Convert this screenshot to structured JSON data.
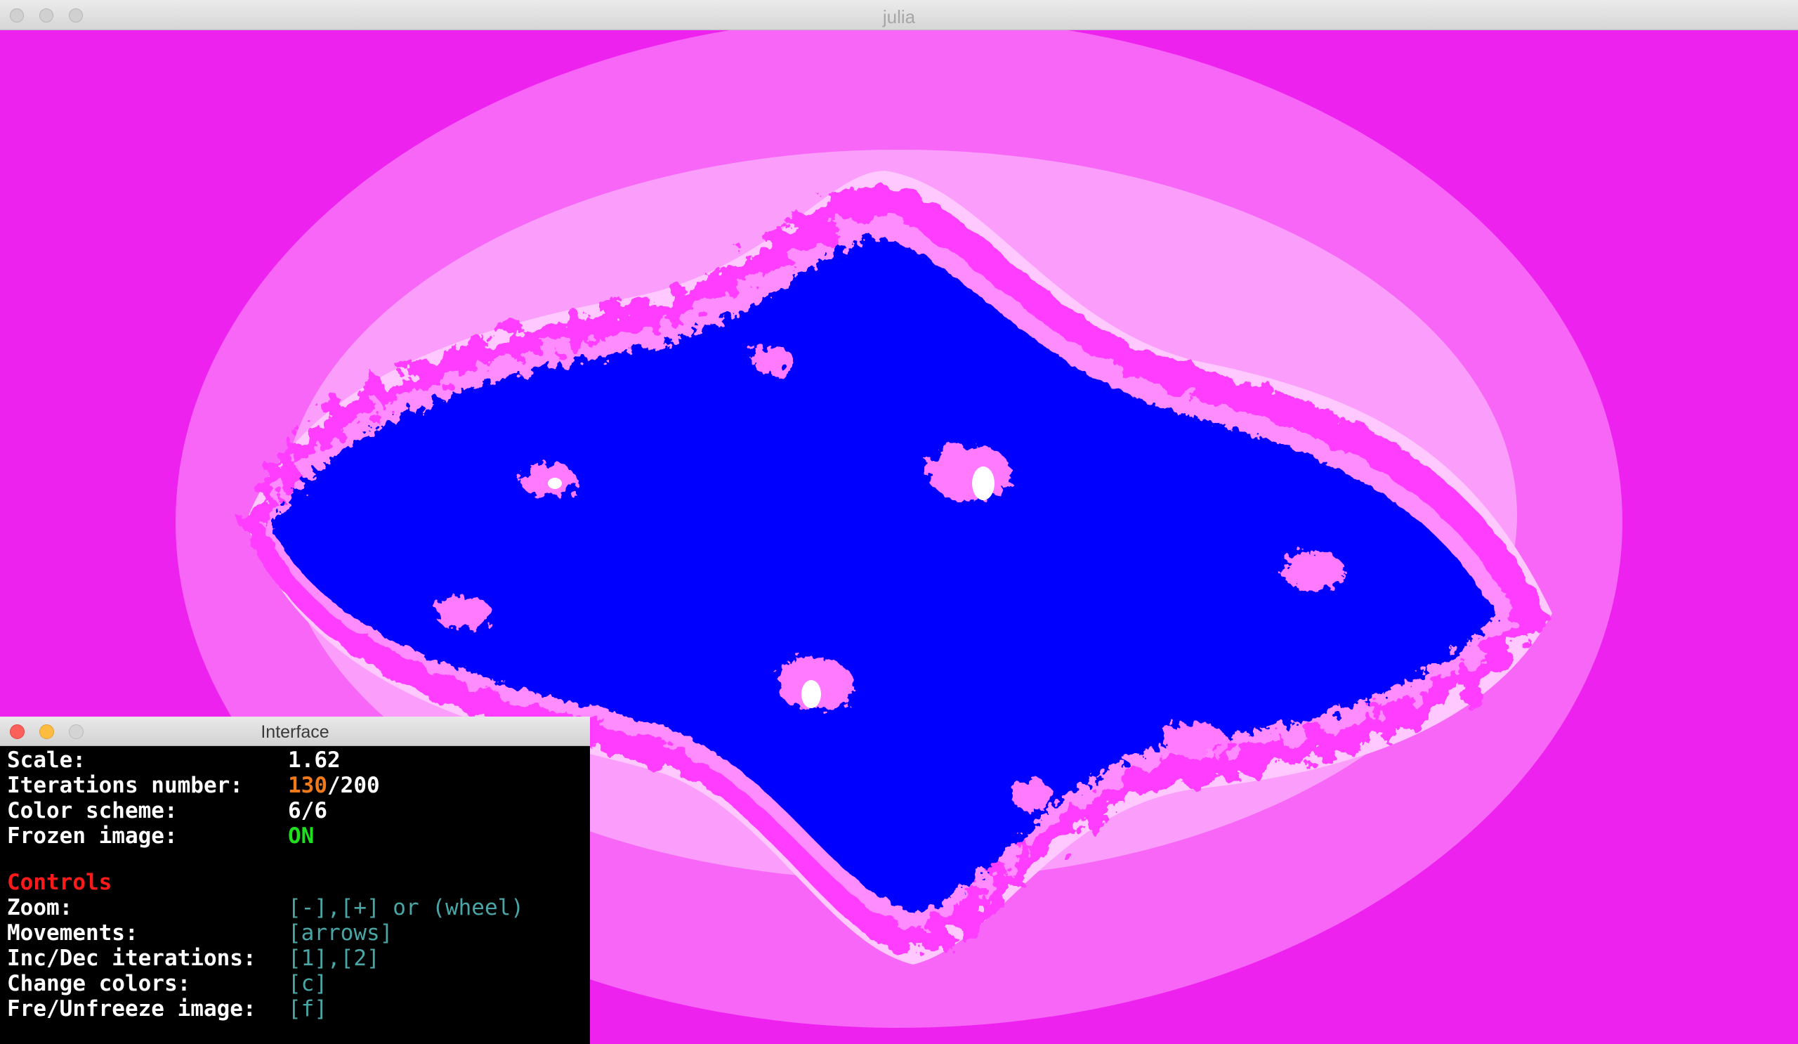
{
  "window": {
    "title": "julia"
  },
  "colors": {
    "background": "#ee22ee",
    "fractal_core": "#0000ff",
    "accent_orange": "#f07a1a",
    "status_green": "#1ee01e",
    "heading_red": "#ff1a1a",
    "key_cyan": "#4aa6a6"
  },
  "interface": {
    "title": "Interface",
    "status": {
      "scale_label": "Scale:",
      "scale_value": "1.62",
      "iterations_label": "Iterations number:",
      "iterations_current": "130",
      "iterations_max": "/200",
      "color_scheme_label": "Color scheme:",
      "color_scheme_value": "6/6",
      "frozen_label": "Frozen image:",
      "frozen_value": "ON"
    },
    "controls": {
      "heading": "Controls",
      "items": [
        {
          "label": "Zoom:",
          "keys": "[-],[+] or (wheel)"
        },
        {
          "label": "Movements:",
          "keys": "[arrows]"
        },
        {
          "label": "Inc/Dec iterations:",
          "keys": "[1],[2]"
        },
        {
          "label": "Change colors:",
          "keys": "[c]"
        },
        {
          "label": "Fre/Unfreeze image:",
          "keys": "[f]"
        }
      ]
    }
  }
}
